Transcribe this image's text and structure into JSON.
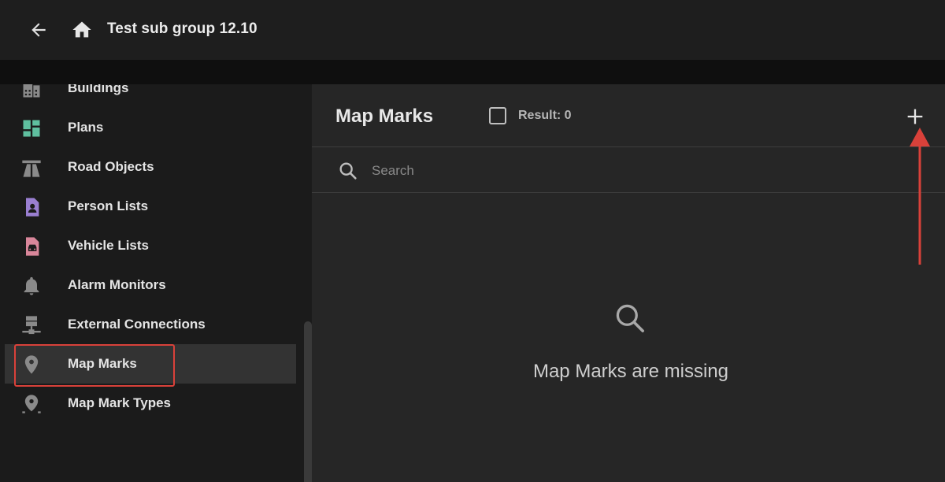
{
  "header": {
    "title": "Test sub group 12.10",
    "back_icon": "arrow-left-icon",
    "home_icon": "home-icon"
  },
  "sidebar": {
    "items": [
      {
        "label": "Buildings",
        "icon": "buildings-icon",
        "color": "#9a9a9a"
      },
      {
        "label": "Plans",
        "icon": "plans-icon",
        "color": "#5fbf9f"
      },
      {
        "label": "Road Objects",
        "icon": "road-icon",
        "color": "#9a9a9a"
      },
      {
        "label": "Person Lists",
        "icon": "person-list-icon",
        "color": "#9a7fd1"
      },
      {
        "label": "Vehicle Lists",
        "icon": "vehicle-list-icon",
        "color": "#d9869a"
      },
      {
        "label": "Alarm Monitors",
        "icon": "bell-icon",
        "color": "#9a9a9a"
      },
      {
        "label": "External Connections",
        "icon": "network-icon",
        "color": "#9a9a9a"
      },
      {
        "label": "Map Marks",
        "icon": "map-pin-icon",
        "color": "#9a9a9a",
        "active": true
      },
      {
        "label": "Map Mark Types",
        "icon": "map-pin-type-icon",
        "color": "#9a9a9a"
      }
    ]
  },
  "main": {
    "title": "Map Marks",
    "result_label": "Result: 0",
    "search_placeholder": "Search",
    "empty_message": "Map Marks are missing",
    "add_icon": "plus-icon"
  },
  "colors": {
    "accent_annotation": "#d9413a",
    "background": "#1b1b1b",
    "panel": "#262626"
  }
}
